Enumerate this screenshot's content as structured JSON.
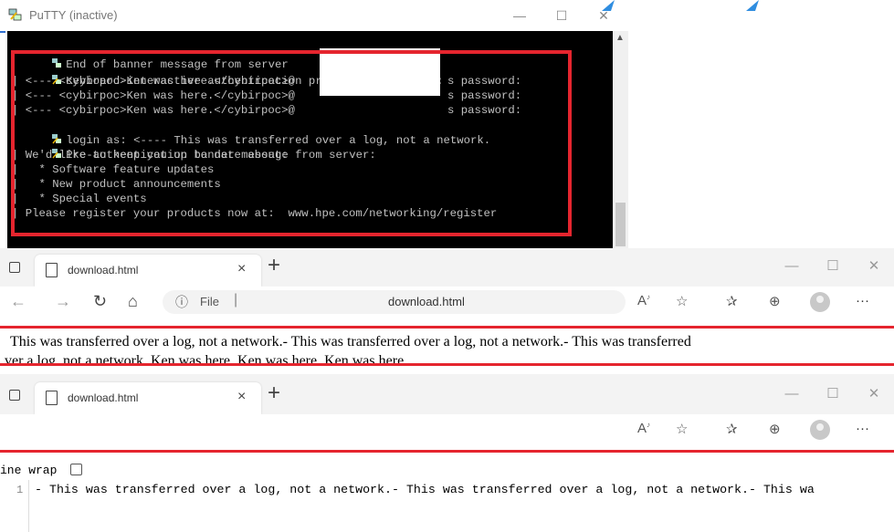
{
  "putty": {
    "title": "PuTTY (inactive)",
    "terminal_lines": [
      "End of banner message from server",
      "Keyboard-interactive authentication prompts from server:",
      "| <--- <cybirpoc>Ken was here.</cybirpoc>@",
      "s password:",
      "| <--- <cybirpoc>Ken was here.</cybirpoc>@",
      "s password:",
      "| <--- <cybirpoc>Ken was here.</cybirpoc>@",
      "s password:",
      "login as: <---- This was transferred over a log, not a network.",
      "Pre-authentication banner message from server:",
      "| We'd like to keep you up to date about:",
      "|   * Software feature updates",
      "|   * New product announcements",
      "|   * Special events",
      "| Please register your products now at:  www.hpe.com/networking/register"
    ],
    "minimize": "—",
    "maximize": "☐",
    "close": "✕"
  },
  "browser1": {
    "tab_title": "download.html",
    "tab_close": "×",
    "new_tab": "+",
    "address_info": "ⓘ",
    "address_label": "File",
    "address_sep": "|",
    "address_url": "download.html",
    "page_line1": "This was transferred over a log, not a network.- This was transferred over a log, not a network.- This was transferred",
    "page_line2": "ver a log, not a network. Ken was here. Ken was here. Ken was here.",
    "window_controls": [
      "—",
      "☐",
      "✕"
    ]
  },
  "browser2": {
    "tab_title": "download.html",
    "tab_close": "×",
    "new_tab": "+",
    "line_wrap_label": "ine wrap",
    "line_number": "1",
    "source_text": "- This was transferred over a log, not a network.- This was transferred over a log, not a network.- This wa",
    "window_controls": [
      "—",
      "☐",
      "✕"
    ]
  },
  "colors": {
    "highlight_red": "#e5252e",
    "terminal_bg": "#000000",
    "terminal_fg": "#c0c0c0"
  }
}
